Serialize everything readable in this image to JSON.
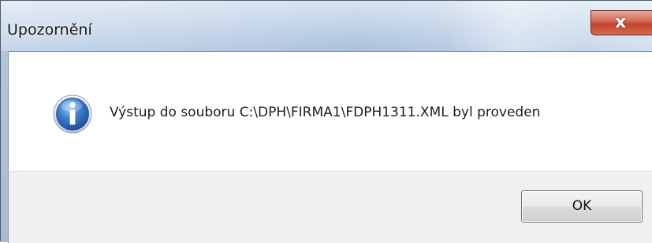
{
  "window": {
    "title": "Upozornění",
    "close_glyph": "x"
  },
  "dialog": {
    "icon": "info-icon",
    "message": "Výstup do souboru C:\\DPH\\FIRMA1\\FDPH1311.XML byl proveden"
  },
  "buttons": {
    "ok_label": "OK"
  },
  "colors": {
    "titlebar": "#b8cce4",
    "close_button": "#c2442c",
    "content_bg": "#ffffff",
    "footer_bg": "#f0f0f0",
    "info_icon": "#2a63b8"
  }
}
